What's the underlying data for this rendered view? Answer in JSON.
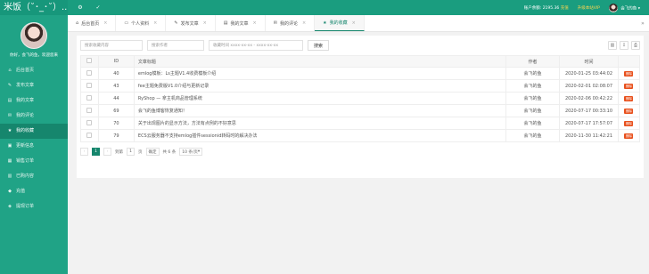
{
  "app": {
    "logo": "米饭（˘･_･˘）..."
  },
  "user": {
    "greeting": "你好，会飞的鱼，欢迎您来"
  },
  "sidebar": {
    "items": [
      {
        "icon": "home-icon",
        "glyph": "⌂",
        "label": "后台首页"
      },
      {
        "icon": "edit-icon",
        "glyph": "✎",
        "label": "发布文章"
      },
      {
        "icon": "file-icon",
        "glyph": "▤",
        "label": "我的文章"
      },
      {
        "icon": "comment-icon",
        "glyph": "✉",
        "label": "我的评论"
      },
      {
        "icon": "star-icon",
        "glyph": "★",
        "label": "我的收藏"
      },
      {
        "icon": "info-icon",
        "glyph": "▣",
        "label": "更新信息"
      },
      {
        "icon": "order-icon",
        "glyph": "▦",
        "label": "销售订单"
      },
      {
        "icon": "box-icon",
        "glyph": "▥",
        "label": "已购内容"
      },
      {
        "icon": "recharge-icon",
        "glyph": "◆",
        "label": "充值"
      },
      {
        "icon": "bill-icon",
        "glyph": "◈",
        "label": "提现订单"
      }
    ],
    "active_index": 4
  },
  "topbar": {
    "balance_label": "账户余额:",
    "balance_value": "2195.36",
    "balance_action": "充值",
    "vip_label": "升级本站VIP",
    "username": "会飞的鱼"
  },
  "tabs": [
    {
      "icon": "home-icon",
      "glyph": "⌂",
      "label": "后台首页",
      "active": false
    },
    {
      "icon": "profile-icon",
      "glyph": "▭",
      "label": "个人资料",
      "active": false
    },
    {
      "icon": "edit-icon",
      "glyph": "✎",
      "label": "发布文章",
      "active": false
    },
    {
      "icon": "file-icon",
      "glyph": "▤",
      "label": "我的文章",
      "active": false
    },
    {
      "icon": "comment-icon",
      "glyph": "✉",
      "label": "我的评论",
      "active": false
    },
    {
      "icon": "star-icon",
      "glyph": "★",
      "label": "我的收藏",
      "active": true
    }
  ],
  "filters": {
    "title_placeholder": "搜索收藏内容",
    "author_placeholder": "搜索作者",
    "date_placeholder": "收藏时间 xxxx-xx-xx - xxxx-xx-xx",
    "search_label": "搜索"
  },
  "table": {
    "headers": {
      "id": "ID",
      "title": "文章标题",
      "author": "作者",
      "time": "时间",
      "op": ""
    },
    "rows": [
      {
        "id": "40",
        "title": "emlog模板：Ls主题V1.4收费模板介绍",
        "author": "会飞的鱼",
        "time": "2020-01-25 03:44:02",
        "op": "删除"
      },
      {
        "id": "43",
        "title": "fee主题免费版V1.0介绍与更新记录",
        "author": "会飞的鱼",
        "time": "2020-02-01 02:08:07",
        "op": "删除"
      },
      {
        "id": "44",
        "title": "RyShop — 拿主机商品管理系统",
        "author": "会飞的鱼",
        "time": "2020-02-06 00:42:22",
        "op": "删除"
      },
      {
        "id": "69",
        "title": "会飞的鱼博客恢复通知！",
        "author": "会飞的鱼",
        "time": "2020-07-17 00:33:10",
        "op": "删除"
      },
      {
        "id": "70",
        "title": "关于出现图片的显示方法，方法有点例的不好意思",
        "author": "会飞的鱼",
        "time": "2020-07-17 17:57:07",
        "op": "删除"
      },
      {
        "id": "79",
        "title": "ECS云服务器不支持emlog插件sessionid转码时的解决办法",
        "author": "会飞的鱼",
        "time": "2020-11-30 11:42:21",
        "op": "删除"
      }
    ]
  },
  "pager": {
    "prev": "‹",
    "current": "1",
    "next": "›",
    "goto_label": "到第",
    "goto_value": "1",
    "page_unit": "页",
    "confirm": "确定",
    "total": "共 6 条",
    "per_page": "10 条/页"
  }
}
